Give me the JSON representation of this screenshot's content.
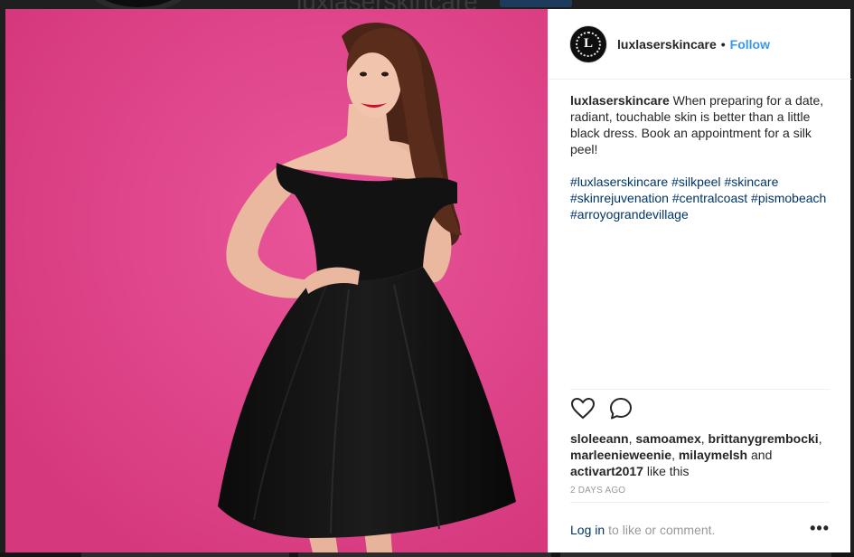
{
  "background": {
    "title": "luxlaserskincare"
  },
  "post": {
    "username": "luxlaserskincare",
    "avatar_letter": "L",
    "separator": "•",
    "follow_label": "Follow",
    "caption_text": "When preparing for a date, radiant, touchable skin is better than a little black dress. Book an appointment for a silk peel!",
    "hashtags": [
      "#luxlaserskincare",
      "#silkpeel",
      "#skincare",
      "#skinrejuvenation",
      "#centralcoast",
      "#pismobeach",
      "#arroyograndevillage"
    ],
    "likes": {
      "users": [
        "sloleeann",
        "samoamex",
        "brittanygrembocki",
        "marleenieweenie",
        "milaymelsh"
      ],
      "and_word": "and",
      "last_user": "activart2017",
      "suffix": "like this"
    },
    "timestamp": "2 days ago",
    "login_label": "Log in",
    "login_suffix": "to like or comment.",
    "more_label": "•••"
  },
  "colors": {
    "photo_background": "#e24a8c",
    "link_blue": "#3897f0",
    "hashtag_blue": "#003569",
    "text_dark": "#262626",
    "muted_gray": "#999999"
  },
  "icons": {
    "like": "heart-outline-icon",
    "comment": "speech-bubble-icon",
    "more": "ellipsis-icon"
  }
}
